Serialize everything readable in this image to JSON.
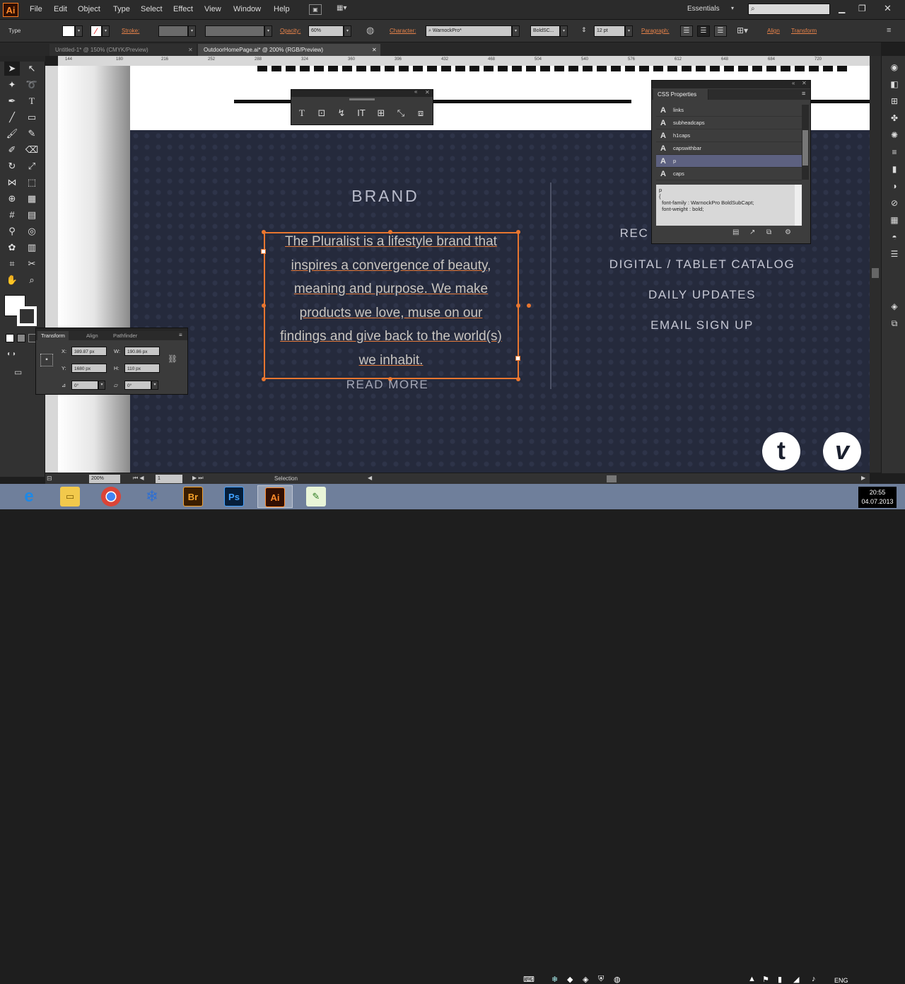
{
  "app": {
    "logo": "Ai",
    "essentials": "Essentials",
    "search_placeholder": ""
  },
  "menu": [
    "File",
    "Edit",
    "Object",
    "Type",
    "Select",
    "Effect",
    "View",
    "Window",
    "Help"
  ],
  "control_bar": {
    "mode": "Type",
    "stroke_label": "Stroke:",
    "opacity_label": "Opacity:",
    "opacity_value": "60%",
    "character_label": "Character:",
    "font_family": "WarnockPro*",
    "font_style": "BoldSC...",
    "font_size": "12 pt",
    "paragraph_label": "Paragraph:",
    "align_label": "Align",
    "transform_label": "Transform"
  },
  "tabs": [
    {
      "label": "Untitled-1* @ 150% (CMYK/Preview)",
      "active": false
    },
    {
      "label": "OutdoorHomePage.ai* @ 200% (RGB/Preview)",
      "active": true
    }
  ],
  "ruler_top": [
    "144",
    "180",
    "216",
    "252",
    "288",
    "324",
    "360",
    "396",
    "432",
    "468",
    "504",
    "540",
    "576",
    "612",
    "648",
    "684",
    "720"
  ],
  "artboard": {
    "brand_title": "BRAND",
    "paragraph_lines": [
      "The Pluralist is a lifestyle brand that",
      "inspires a convergence of beauty,",
      "meaning and purpose. We make",
      "products we love, muse on our",
      "findings and give back to the world(s)",
      "we inhabit."
    ],
    "read_more": "READ MORE",
    "nav_links": [
      "REC",
      "DIGITAL / TABLET CATALOG",
      "DAILY UPDATES",
      "EMAIL SIGN UP"
    ],
    "social": {
      "twitter": "t",
      "vimeo": "v"
    }
  },
  "css_panel": {
    "title": "CSS Properties",
    "rows": [
      "links",
      "subheadcaps",
      "h1caps",
      "capswithbar",
      "p",
      "caps"
    ],
    "selected_index": 4,
    "code": [
      "p",
      "{",
      "  font-family : WarnockPro BoldSubCapt;",
      "  font-weight : bold;"
    ]
  },
  "transform_panel": {
    "tabs": [
      "Transform",
      "Align",
      "Pathfinder"
    ],
    "x_label": "X:",
    "x_value": "389.87 px",
    "y_label": "Y:",
    "y_value": "1680 px",
    "w_label": "W:",
    "w_value": "190.86 px",
    "h_label": "H:",
    "h_value": "110 px",
    "rotate_value": "0°",
    "shear_value": "0°"
  },
  "status": {
    "zoom": "200%",
    "page": "1",
    "tool": "Selection"
  },
  "taskbar": {
    "apps": [
      "IE",
      "Explorer",
      "Chrome",
      "Snowflake",
      "Br",
      "Ps",
      "Ai",
      "Notepad"
    ],
    "time": "20:55",
    "date": "04.07.2013",
    "lang": "ENG"
  },
  "colors": {
    "accent": "#e8762f",
    "navy": "#252a3c",
    "ui_bg": "#323232"
  }
}
